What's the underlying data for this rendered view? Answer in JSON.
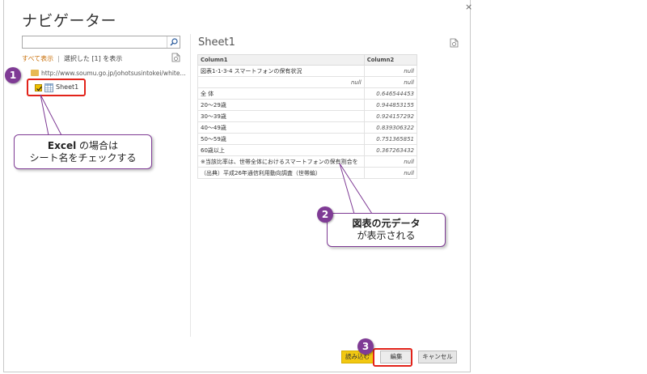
{
  "window": {
    "title": "ナビゲーター",
    "close_glyph": "×"
  },
  "search": {
    "value": "",
    "placeholder": ""
  },
  "filter": {
    "show_all": "すべて表示",
    "separator": "|",
    "show_selected": "選択した [1] を表示"
  },
  "tree": {
    "source_url": "http://www.soumu.go.jp/johotsusintokei/white...",
    "sheet_label": "Sheet1"
  },
  "preview": {
    "title": "Sheet1",
    "columns": [
      "Column1",
      "Column2"
    ],
    "rows": [
      [
        "図表1-1-3-4 スマートフォンの保有状況",
        "null"
      ],
      [
        "null",
        "null"
      ],
      [
        "全 体",
        "0.646544453"
      ],
      [
        "20～29歳",
        "0.944853155"
      ],
      [
        "30～39歳",
        "0.924157292"
      ],
      [
        "40～49歳",
        "0.839306322"
      ],
      [
        "50～59歳",
        "0.751365851"
      ],
      [
        "60歳以上",
        "0.367263432"
      ],
      [
        "※当該比率は、世帯全体におけるスマートフォンの保有割合を",
        "null"
      ],
      [
        "（出典）平成26年通信利用動向調査（世帯編）",
        "null"
      ]
    ]
  },
  "buttons": {
    "load": "読み込む",
    "edit": "編集",
    "cancel": "キャンセル"
  },
  "annotations": {
    "badge1": "1",
    "badge2": "2",
    "badge3": "3",
    "callout1_bold": "Excel",
    "callout1_line1_rest": " の場合は",
    "callout1_line2": "シート名をチェックする",
    "callout2_bold": "図表の元データ",
    "callout2_line2": "が表示される"
  },
  "colors": {
    "accent_yellow": "#f2c811",
    "badge_purple": "#7f3b95",
    "highlight_red": "#e2231a",
    "link_orange": "#c9700b"
  },
  "icons": [
    "search-icon",
    "refresh-icon",
    "folder-icon",
    "sheet-icon",
    "check-icon",
    "close-icon"
  ]
}
